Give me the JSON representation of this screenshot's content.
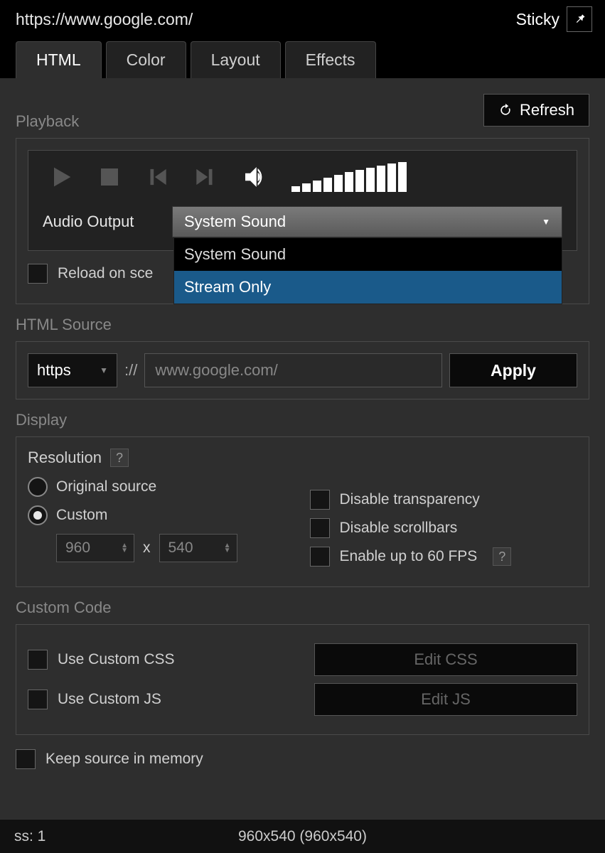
{
  "topbar": {
    "url": "https://www.google.com/",
    "sticky_label": "Sticky"
  },
  "tabs": [
    "HTML",
    "Color",
    "Layout",
    "Effects"
  ],
  "active_tab": 0,
  "refresh_label": "Refresh",
  "sections": {
    "playback": "Playback",
    "html_source": "HTML Source",
    "display": "Display",
    "custom_code": "Custom Code"
  },
  "playback": {
    "audio_output_label": "Audio Output",
    "audio_output_selected": "System Sound",
    "audio_output_options": [
      "System Sound",
      "Stream Only"
    ],
    "audio_output_highlight": 1,
    "reload_checkbox_label": "Reload on sce"
  },
  "html_source": {
    "protocol": "https",
    "separator": "://",
    "url_value": "www.google.com/",
    "apply_label": "Apply"
  },
  "display": {
    "resolution_label": "Resolution",
    "radio_original": "Original source",
    "radio_custom": "Custom",
    "radio_selected": "custom",
    "width": "960",
    "height": "540",
    "dim_sep": "x",
    "chk_transparency": "Disable transparency",
    "chk_scrollbars": "Disable scrollbars",
    "chk_fps": "Enable up to 60 FPS"
  },
  "custom_code": {
    "use_css_label": "Use Custom CSS",
    "use_js_label": "Use Custom JS",
    "edit_css_label": "Edit CSS",
    "edit_js_label": "Edit JS"
  },
  "keep_source_label": "Keep source in memory",
  "status": {
    "left": "ss: 1",
    "center": "960x540 (960x540)"
  }
}
